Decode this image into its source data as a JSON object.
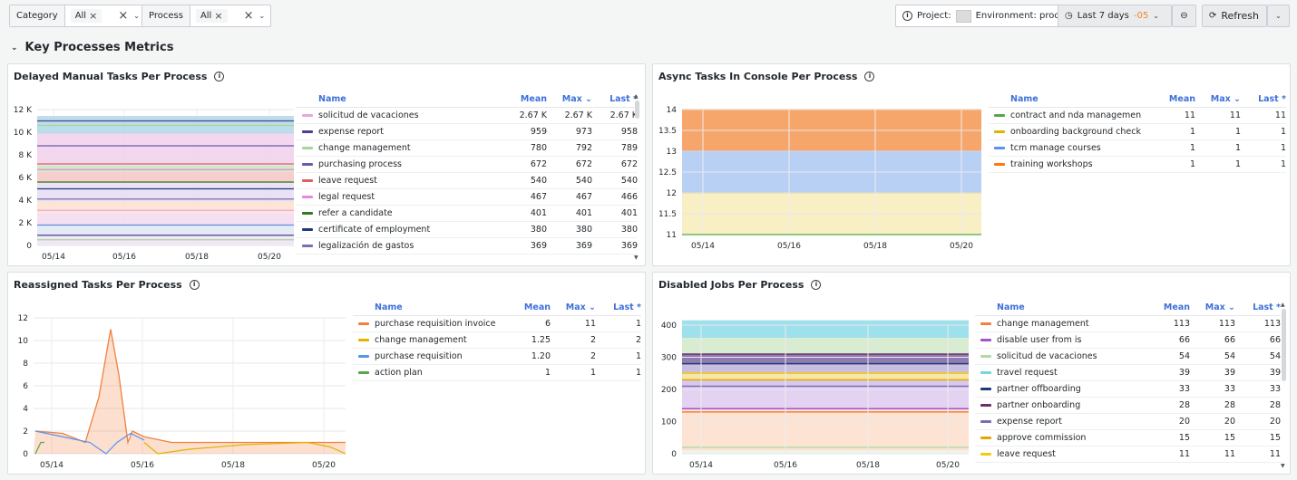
{
  "toolbar": {
    "category_label": "Category",
    "category_value": "All",
    "process_label": "Process",
    "process_value": "All",
    "project_label": "Project:",
    "environment_label": "Environment: prod",
    "time_range": "Last 7 days",
    "timezone": "-05",
    "refresh_label": "Refresh"
  },
  "row": {
    "title": "Key Processes Metrics"
  },
  "legend_headers": {
    "name": "Name",
    "mean": "Mean",
    "max": "Max",
    "last": "Last *"
  },
  "panels": {
    "delayed": {
      "title": "Delayed Manual Tasks Per Process",
      "yticks": [
        "12 K",
        "10 K",
        "8 K",
        "6 K",
        "4 K",
        "2 K",
        "0"
      ],
      "xticks": [
        "05/14",
        "05/16",
        "05/18",
        "05/20"
      ],
      "rows": [
        {
          "name": "solicitud de vacaciones",
          "mean": "2.67 K",
          "max": "2.67 K",
          "last": "2.67 K",
          "color": "#e7a6e1"
        },
        {
          "name": "expense report",
          "mean": "959",
          "max": "973",
          "last": "958",
          "color": "#4b3f8f"
        },
        {
          "name": "change management",
          "mean": "780",
          "max": "792",
          "last": "789",
          "color": "#a7d59a"
        },
        {
          "name": "purchasing process",
          "mean": "672",
          "max": "672",
          "last": "672",
          "color": "#6b5ba8"
        },
        {
          "name": "leave request",
          "mean": "540",
          "max": "540",
          "last": "540",
          "color": "#e05f5f"
        },
        {
          "name": "legal request",
          "mean": "467",
          "max": "467",
          "last": "466",
          "color": "#e68ad8"
        },
        {
          "name": "refer a candidate",
          "mean": "401",
          "max": "401",
          "last": "401",
          "color": "#2f7a1f"
        },
        {
          "name": "certificate of employment",
          "mean": "380",
          "max": "380",
          "last": "380",
          "color": "#1f3a7a"
        },
        {
          "name": "legalización de gastos",
          "mean": "369",
          "max": "369",
          "last": "369",
          "color": "#7e6bb3"
        }
      ]
    },
    "async": {
      "title": "Async Tasks In Console Per Process",
      "yticks": [
        "14",
        "13.5",
        "13",
        "12.5",
        "12",
        "11.5",
        "11"
      ],
      "xticks": [
        "05/14",
        "05/16",
        "05/18",
        "05/20"
      ],
      "rows": [
        {
          "name": "contract and nda management",
          "mean": "11",
          "max": "11",
          "last": "11",
          "color": "#56a64b"
        },
        {
          "name": "onboarding background checks",
          "mean": "1",
          "max": "1",
          "last": "1",
          "color": "#e0b400"
        },
        {
          "name": "tcm manage courses",
          "mean": "1",
          "max": "1",
          "last": "1",
          "color": "#5794f2"
        },
        {
          "name": "training workshops",
          "mean": "1",
          "max": "1",
          "last": "1",
          "color": "#ff780a"
        }
      ]
    },
    "reassigned": {
      "title": "Reassigned Tasks Per Process",
      "yticks": [
        "12",
        "10",
        "8",
        "6",
        "4",
        "2",
        "0"
      ],
      "xticks": [
        "05/14",
        "05/16",
        "05/18",
        "05/20"
      ],
      "rows": [
        {
          "name": "purchase requisition invoices",
          "mean": "6",
          "max": "11",
          "last": "1",
          "color": "#f2813d"
        },
        {
          "name": "change management",
          "mean": "1.25",
          "max": "2",
          "last": "2",
          "color": "#e0b400"
        },
        {
          "name": "purchase requisition",
          "mean": "1.20",
          "max": "2",
          "last": "1",
          "color": "#5794f2"
        },
        {
          "name": "action plan",
          "mean": "1",
          "max": "1",
          "last": "1",
          "color": "#56a64b"
        }
      ]
    },
    "disabled": {
      "title": "Disabled Jobs Per Process",
      "yticks": [
        "400",
        "300",
        "200",
        "100",
        "0"
      ],
      "xticks": [
        "05/14",
        "05/16",
        "05/18",
        "05/20"
      ],
      "rows": [
        {
          "name": "change management",
          "mean": "113",
          "max": "113",
          "last": "113",
          "color": "#f2813d"
        },
        {
          "name": "disable user from is",
          "mean": "66",
          "max": "66",
          "last": "66",
          "color": "#a352cc"
        },
        {
          "name": "solicitud de vacaciones",
          "mean": "54",
          "max": "54",
          "last": "54",
          "color": "#b5d9a6"
        },
        {
          "name": "travel request",
          "mean": "39",
          "max": "39",
          "last": "39",
          "color": "#6fd9dc"
        },
        {
          "name": "partner offboarding",
          "mean": "33",
          "max": "33",
          "last": "33",
          "color": "#1f3a7a"
        },
        {
          "name": "partner onboarding",
          "mean": "28",
          "max": "28",
          "last": "28",
          "color": "#6e2d6e"
        },
        {
          "name": "expense report",
          "mean": "20",
          "max": "20",
          "last": "20",
          "color": "#7e6bb3"
        },
        {
          "name": "approve commission",
          "mean": "15",
          "max": "15",
          "last": "15",
          "color": "#e0a800"
        },
        {
          "name": "leave request",
          "mean": "11",
          "max": "11",
          "last": "11",
          "color": "#f2cc0c"
        }
      ]
    }
  }
}
